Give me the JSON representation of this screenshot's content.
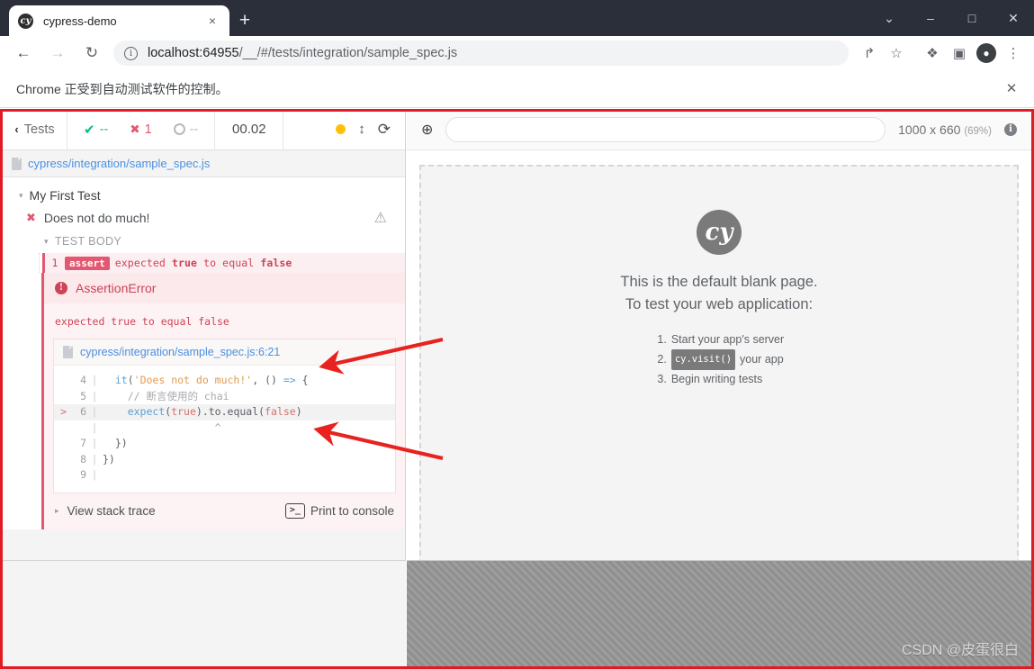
{
  "browser": {
    "tab": {
      "title": "cypress-demo",
      "favicon": "cy",
      "close": "×"
    },
    "new_tab": "+",
    "window_controls": {
      "minimize_group": "⌄",
      "minimize": "–",
      "maximize": "□",
      "close": "✕"
    },
    "nav": {
      "back": "←",
      "forward": "→",
      "reload": "↻"
    },
    "omnibox": {
      "info_icon": "i",
      "url_host": "localhost:64955",
      "url_path": "/__/#/tests/integration/sample_spec.js",
      "share_icon": "↱",
      "bookmark_icon": "☆",
      "extensions_icon": "❖",
      "sidepanel_icon": "▣",
      "profile_icon": "●",
      "menu_icon": "⋮"
    },
    "infobar": {
      "message": "Chrome 正受到自动测试软件的控制。",
      "close": "✕"
    }
  },
  "reporter": {
    "back_label": "Tests",
    "back_chevron": "‹",
    "stats": {
      "passed": {
        "icon": "✔",
        "value": "--"
      },
      "failed": {
        "icon": "✖",
        "value": "1"
      },
      "pending": {
        "icon": "",
        "value": "--"
      }
    },
    "timer": "00.02",
    "controls": {
      "paused_dot": "",
      "step_icon": "↕",
      "restart_icon": "⟳"
    },
    "spec_path": "cypress/integration/sample_spec.js",
    "suite": {
      "caret": "▾",
      "name": "My First Test"
    },
    "test": {
      "icon": "✖",
      "name": "Does not do much!",
      "warning_icon": "⚠"
    },
    "test_body_label": "TEST BODY",
    "test_body_caret": "▾",
    "commands": [
      {
        "num": "1",
        "name": "assert",
        "message_pre": "expected ",
        "message_true": "true",
        "message_mid": " to equal ",
        "message_false": "false"
      }
    ],
    "error": {
      "badge": "!",
      "title": "AssertionError",
      "message": "expected true to equal false",
      "codeframe_file": "cypress/integration/sample_spec.js:6:21",
      "code_lines": [
        {
          "mark": "",
          "ln": "4",
          "bar": "|",
          "highlight": false,
          "tokens": [
            {
              "t": "  ",
              "c": "tok-pl"
            },
            {
              "t": "it",
              "c": "tok-fn"
            },
            {
              "t": "(",
              "c": "tok-pl"
            },
            {
              "t": "'Does not do much!'",
              "c": "tok-str"
            },
            {
              "t": ", () ",
              "c": "tok-pl"
            },
            {
              "t": "=>",
              "c": "tok-fn"
            },
            {
              "t": " {",
              "c": "tok-pl"
            }
          ]
        },
        {
          "mark": "",
          "ln": "5",
          "bar": "|",
          "highlight": false,
          "tokens": [
            {
              "t": "    // 断言使用的 chai",
              "c": "tok-com"
            }
          ]
        },
        {
          "mark": ">",
          "ln": "6",
          "bar": "|",
          "highlight": true,
          "tokens": [
            {
              "t": "    ",
              "c": "tok-pl"
            },
            {
              "t": "expect",
              "c": "tok-fn"
            },
            {
              "t": "(",
              "c": "tok-pl"
            },
            {
              "t": "true",
              "c": "tok-val"
            },
            {
              "t": ").to.",
              "c": "tok-pl"
            },
            {
              "t": "equal",
              "c": "tok-pl"
            },
            {
              "t": "(",
              "c": "tok-pl"
            },
            {
              "t": "false",
              "c": "tok-val"
            },
            {
              "t": ")",
              "c": "tok-pl"
            }
          ]
        },
        {
          "mark": "",
          "ln": "",
          "bar": "|",
          "highlight": false,
          "tokens": [
            {
              "t": "                  ^",
              "c": "tok-caret"
            }
          ]
        },
        {
          "mark": "",
          "ln": "7",
          "bar": "|",
          "highlight": false,
          "tokens": [
            {
              "t": "  })",
              "c": "tok-pl"
            }
          ]
        },
        {
          "mark": "",
          "ln": "8",
          "bar": "|",
          "highlight": false,
          "tokens": [
            {
              "t": "})",
              "c": "tok-pl"
            }
          ]
        },
        {
          "mark": "",
          "ln": "9",
          "bar": "|",
          "highlight": false,
          "tokens": [
            {
              "t": "",
              "c": "tok-pl"
            }
          ]
        }
      ],
      "stack_toggle_label": "View stack trace",
      "stack_toggle_caret": "▸",
      "print_console_label": "Print to console",
      "terminal_icon": ">_"
    }
  },
  "aut": {
    "selector_icon": "⊕",
    "url_value": "",
    "url_placeholder": "",
    "viewport_size": "1000 x 660",
    "viewport_scale": "(69%)",
    "info_icon": "i",
    "blank_page": {
      "logo": "cy",
      "line1": "This is the default blank page.",
      "line2": "To test your web application:",
      "steps": [
        {
          "no": "1.",
          "pre": "Start your app's server",
          "chip": "",
          "post": ""
        },
        {
          "no": "2.",
          "pre": "",
          "chip": "cy.visit()",
          "post": "your app"
        },
        {
          "no": "3.",
          "pre": "Begin writing tests",
          "chip": "",
          "post": ""
        }
      ]
    }
  },
  "annotations": {
    "watermark": "CSDN @皮蛋很白",
    "highlight_color": "#e01b24",
    "arrow_color": "#e8231f"
  }
}
